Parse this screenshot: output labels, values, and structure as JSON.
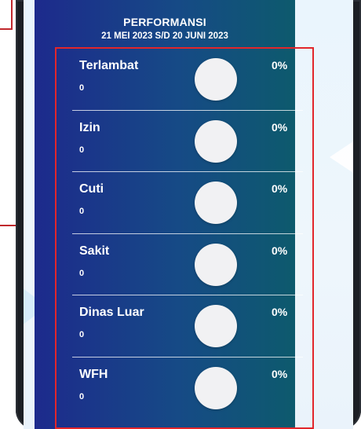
{
  "performance": {
    "title": "PERFORMANSI",
    "period": "21 MEI 2023 S/D 20 JUNI 2023",
    "items": [
      {
        "label": "Terlambat",
        "count": "0",
        "percent": "0%"
      },
      {
        "label": "Izin",
        "count": "0",
        "percent": "0%"
      },
      {
        "label": "Cuti",
        "count": "0",
        "percent": "0%"
      },
      {
        "label": "Sakit",
        "count": "0",
        "percent": "0%"
      },
      {
        "label": "Dinas Luar",
        "count": "0",
        "percent": "0%"
      },
      {
        "label": "WFH",
        "count": "0",
        "percent": "0%"
      }
    ]
  },
  "colors": {
    "card_gradient_start": "#1d2a8c",
    "card_gradient_end": "#0d5a6d",
    "highlight_border": "#e2262b",
    "chart_circle": "#f1f1f3"
  }
}
